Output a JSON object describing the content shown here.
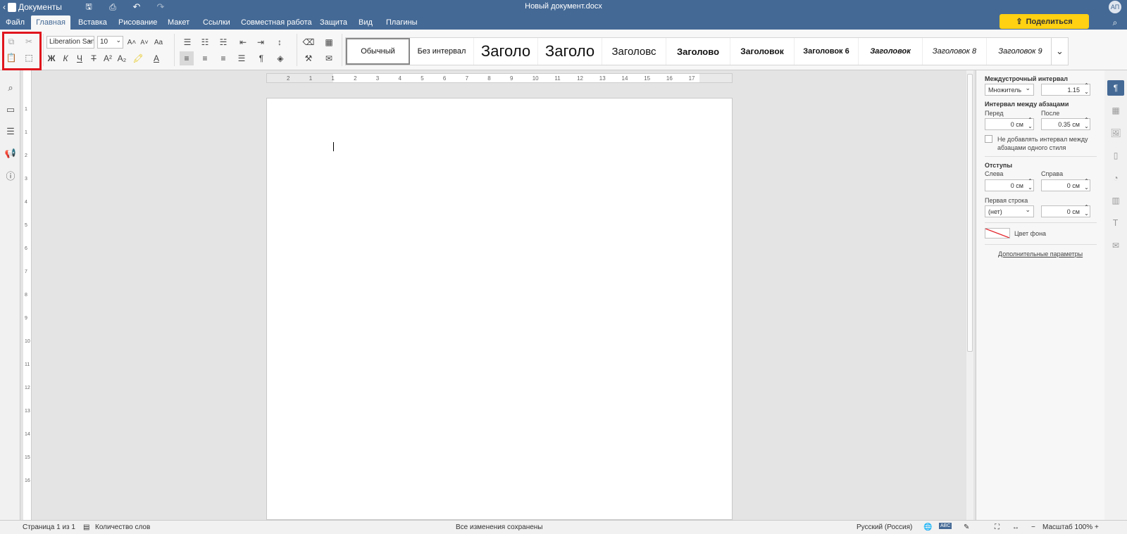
{
  "app": {
    "back_label": "Документы",
    "doc_title": "Новый документ.docx",
    "avatar": "АП"
  },
  "menu": {
    "tabs": [
      "Файл",
      "Главная",
      "Вставка",
      "Рисование",
      "Макет",
      "Ссылки",
      "Совместная работа",
      "Защита",
      "Вид",
      "Плагины"
    ],
    "active": "Главная"
  },
  "share_label": "Поделиться",
  "font": {
    "name": "Liberation Sans",
    "size": "10"
  },
  "styles": [
    "Обычный",
    "Без интервал",
    "Заголо",
    "Заголо",
    "Заголовс",
    "Заголово",
    "Заголовок",
    "Заголовок 6",
    "Заголовок",
    "Заголовок 8",
    "Заголовок 9"
  ],
  "ruler": {
    "h_ticks": [
      "2",
      "1",
      "1",
      "2",
      "3",
      "4",
      "5",
      "6",
      "7",
      "8",
      "9",
      "10",
      "11",
      "12",
      "13",
      "14",
      "15",
      "16",
      "17"
    ],
    "v_ticks": [
      "1",
      "1",
      "2",
      "3",
      "4",
      "5",
      "6",
      "7",
      "8",
      "9",
      "10",
      "11",
      "12",
      "13",
      "14",
      "15",
      "16"
    ]
  },
  "panel": {
    "line_spacing_title": "Междустрочный интервал",
    "line_spacing_mode": "Множитель",
    "line_spacing_value": "1.15",
    "para_spacing_title": "Интервал между абзацами",
    "before_label": "Перед",
    "after_label": "После",
    "before_value": "0 см",
    "after_value": "0.35 см",
    "no_space_label": "Не добавлять интервал между абзацами одного стиля",
    "indents_title": "Отступы",
    "left_label": "Слева",
    "right_label": "Справа",
    "left_value": "0 см",
    "right_value": "0 см",
    "first_line_label": "Первая строка",
    "first_line_mode": "(нет)",
    "first_line_value": "0 см",
    "bg_color_label": "Цвет фона",
    "advanced_label": "Дополнительные параметры"
  },
  "status": {
    "page": "Страница 1 из 1",
    "word_count": "Количество слов",
    "saved": "Все изменения сохранены",
    "language": "Русский (Россия)",
    "zoom": "Масштаб 100%"
  },
  "colors": {
    "header": "#446995",
    "share": "#ffd112",
    "highlight_box": "#e0151d"
  }
}
